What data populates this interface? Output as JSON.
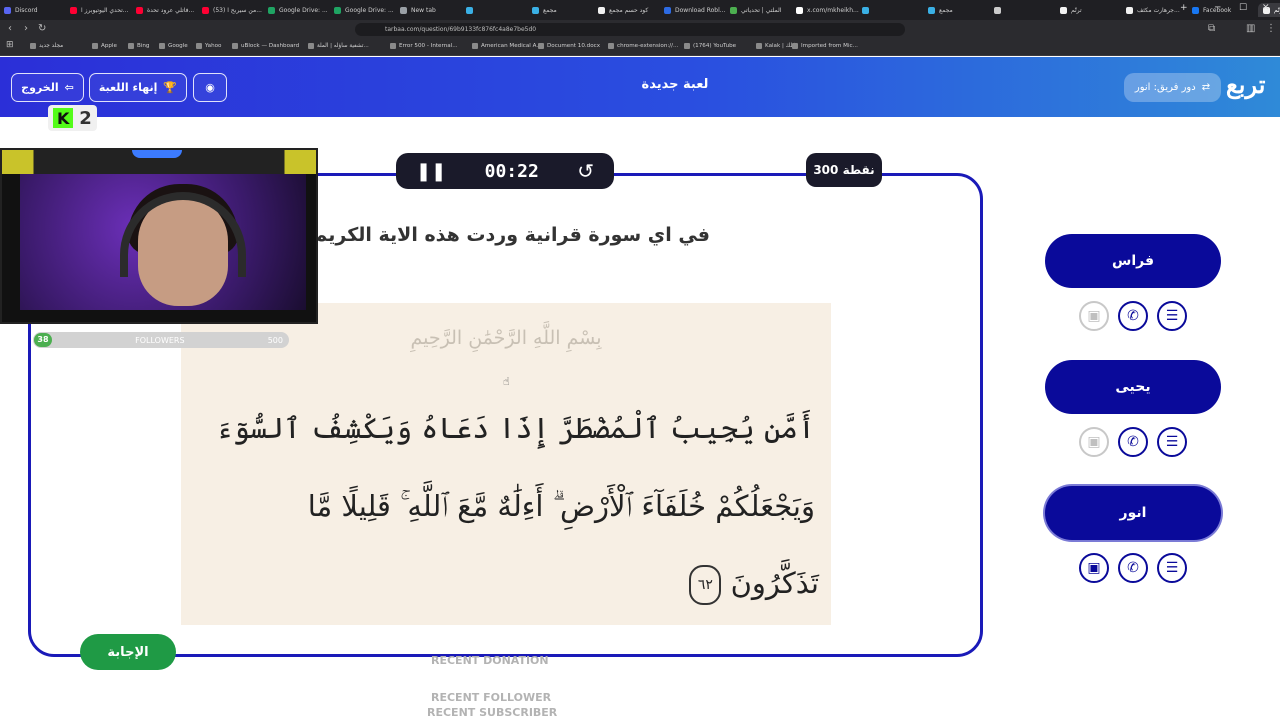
{
  "browser": {
    "tabs": [
      {
        "label": "Discord",
        "color": "#5865f2"
      },
      {
        "label": "تحدي اليوتيوبرز ا...",
        "color": "#ff0033"
      },
      {
        "label": "فاتلي عرود تحدة...",
        "color": "#ff0033"
      },
      {
        "label": "(53) من سيربح ا...",
        "color": "#ff0033"
      },
      {
        "label": "Google Drive: ...",
        "color": "#1fa463"
      },
      {
        "label": "Google Drive: ...",
        "color": "#1fa463"
      },
      {
        "label": "New tab",
        "color": "#9aa0a6"
      },
      {
        "label": "",
        "color": "#3ab0e5"
      },
      {
        "label": "مجمع",
        "color": "#3ab0e5"
      },
      {
        "label": "كود حسم مجمع",
        "color": "#f1f1f1"
      },
      {
        "label": "Download Robl...",
        "color": "#2d6be4"
      },
      {
        "label": "الملتي | تحدياتي",
        "color": "#4caf50"
      },
      {
        "label": "x.com/mkheikh...",
        "color": "#ffffff"
      },
      {
        "label": "",
        "color": "#3ab0e5"
      },
      {
        "label": "مجمع",
        "color": "#3ab0e5"
      },
      {
        "label": "",
        "color": "#cccccc"
      },
      {
        "label": "ترتّم",
        "color": "#f1f1f1"
      },
      {
        "label": "جرهارت مكثف...",
        "color": "#f1f1f1"
      },
      {
        "label": "Facebook",
        "color": "#1877f2"
      },
      {
        "label": "ترتّم",
        "color": "#f1f1f1",
        "active": true
      }
    ],
    "url": "tarbaa.com/question/69b9133fc876fc4a8e7be5d0",
    "bookmarks": [
      "مجلد جديد",
      "Apple",
      "Bing",
      "Google",
      "Yahoo",
      "uBlock — Dashboard",
      "تشفية ساؤله | الملة...",
      "Error 500 - Internal...",
      "American Medical A...",
      "Document 10.docx",
      "chrome-extension://...",
      "(1764) YouTube",
      "Kalak | كلك",
      "Imported from Mic..."
    ]
  },
  "header": {
    "exit_label": "الخروج",
    "end_game_label": "إنهاء اللعبة",
    "title": "لعبة جديدة",
    "turn_label": "دور فريق: انور",
    "brand": "تربع",
    "accent": "#2a4fe0"
  },
  "game": {
    "timer": "00:22",
    "points": "300 نقطة",
    "question": "في اي سورة قرانية وردت هذه الاية الكريمة",
    "answer_label": "الإجابة",
    "quran": {
      "basmala": "بِسْمِ اللَّهِ الرَّحْمَٰنِ الرَّحِيمِ",
      "lines": [
        "أَمَّن يُجِيبُ ٱلْمُضْطَرَّ إِذَا دَعَاهُ وَيَكْشِفُ ٱلسُّوٓءَ",
        "وَيَجْعَلُكُمْ خُلَفَآءَ ٱلْأَرْضِ ۗ أَءِلَٰهٌ مَّعَ ٱللَّهِ ۚ قَلِيلًا مَّا",
        "تَذَكَّرُونَ"
      ],
      "ayah_number": "٦٢"
    }
  },
  "stream": {
    "kick_count": "2",
    "followers": {
      "current": "38",
      "label": "FOLLOWERS",
      "goal": "500",
      "progress": 0.076
    },
    "recent_donation": "RECENT DONATION",
    "recent_follower": "RECENT FOLLOWER",
    "recent_subscriber": "RECENT SUBSCRIBER"
  },
  "players": [
    {
      "name": "فراس",
      "current": false,
      "camera_enabled": false
    },
    {
      "name": "يحيى",
      "current": false,
      "camera_enabled": false
    },
    {
      "name": "انور",
      "current": true,
      "camera_enabled": true
    }
  ]
}
